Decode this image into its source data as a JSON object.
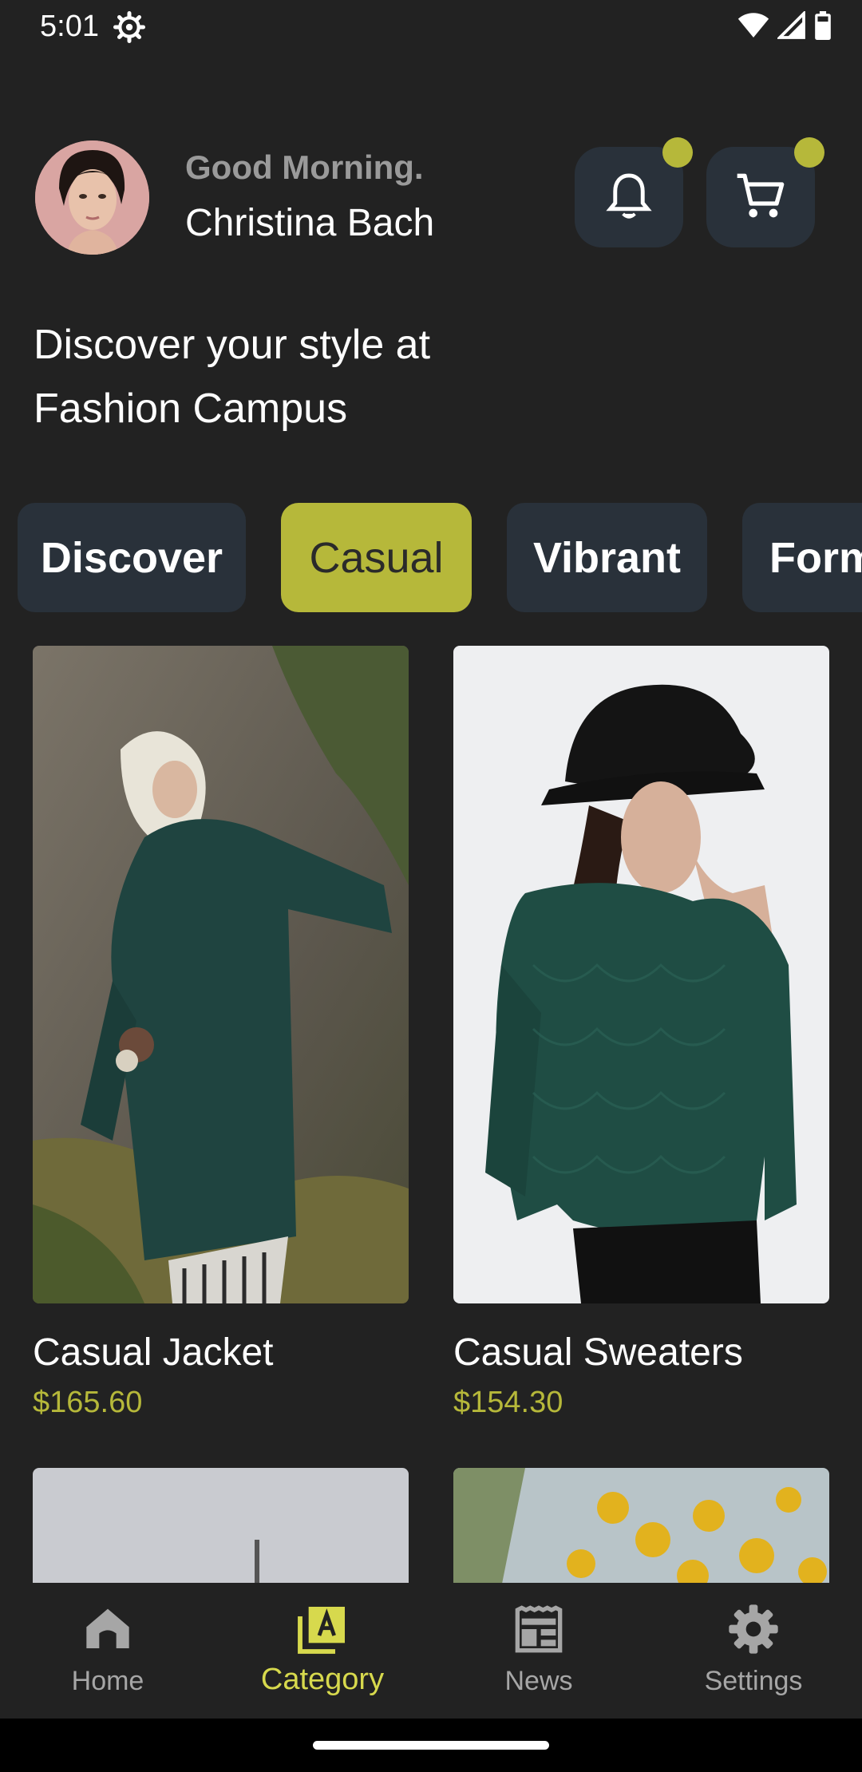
{
  "status": {
    "time": "5:01"
  },
  "header": {
    "greeting": "Good Morning.",
    "user_name": "Christina Bach"
  },
  "headline": "Discover your style at Fashion Campus",
  "chips": [
    {
      "label": "Discover",
      "active": false
    },
    {
      "label": "Casual",
      "active": true
    },
    {
      "label": "Vibrant",
      "active": false
    },
    {
      "label": "Form",
      "active": false
    }
  ],
  "products": [
    {
      "name": "Casual Jacket",
      "price": "$165.60"
    },
    {
      "name": "Casual Sweaters",
      "price": "$154.30"
    }
  ],
  "nav": [
    {
      "label": "Home",
      "icon": "home-icon",
      "active": false
    },
    {
      "label": "Category",
      "icon": "category-icon",
      "active": true
    },
    {
      "label": "News",
      "icon": "news-icon",
      "active": false
    },
    {
      "label": "Settings",
      "icon": "settings-icon",
      "active": false
    }
  ],
  "colors": {
    "background": "#222222",
    "accent": "#b6b83a",
    "card_bg": "#29313a",
    "muted_text": "#a6a6a6"
  }
}
